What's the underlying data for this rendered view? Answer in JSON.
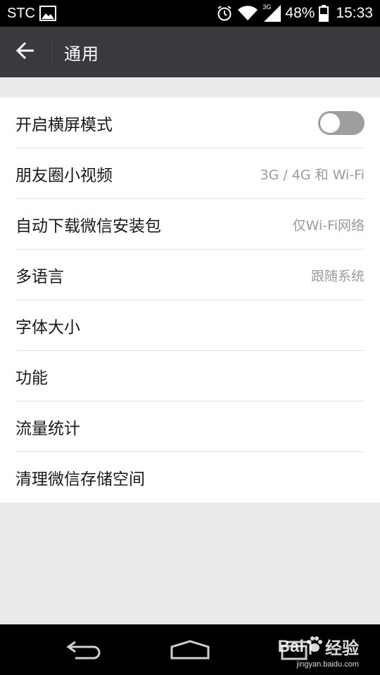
{
  "status_bar": {
    "carrier": "STC",
    "network_type": "3G",
    "battery": "48%",
    "time": "15:33",
    "icons": [
      "gallery-icon",
      "alarm-icon",
      "wifi-icon",
      "signal-icon",
      "battery-icon"
    ]
  },
  "header": {
    "title": "通用",
    "back_icon": "back-arrow-icon"
  },
  "settings": [
    {
      "label": "开启横屏模式",
      "type": "toggle",
      "state": "off"
    },
    {
      "label": "朋友圈小视频",
      "value": "3G / 4G 和 Wi-Fi"
    },
    {
      "label": "自动下载微信安装包",
      "value": "仅Wi-Fi网络"
    },
    {
      "label": "多语言",
      "value": "跟随系统"
    },
    {
      "label": "字体大小",
      "value": ""
    },
    {
      "label": "功能",
      "value": ""
    },
    {
      "label": "流量统计",
      "value": ""
    },
    {
      "label": "清理微信存储空间",
      "value": ""
    }
  ],
  "nav_bar": {
    "icons": [
      "nav-back-icon",
      "nav-home-icon",
      "nav-recents-icon"
    ]
  },
  "watermark": {
    "logo_text_1": "Bai",
    "logo_text_2": "经验",
    "url": "jingyan.baidu.com"
  },
  "colors": {
    "header_bg": "#393a3f",
    "page_bg": "#ebebeb",
    "toggle_off": "#9e9e9e"
  }
}
